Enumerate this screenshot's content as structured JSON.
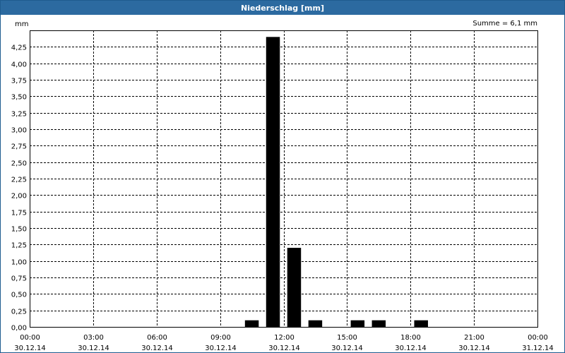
{
  "window": {
    "title": "Niederschlag [mm]"
  },
  "chart_data": {
    "type": "bar",
    "title": "Niederschlag [mm]",
    "ylabel": "mm",
    "annotation": "Summe = 6,1 mm",
    "ylim": [
      0,
      4.5
    ],
    "yticks": [
      "0,00",
      "0,25",
      "0,50",
      "0,75",
      "1,00",
      "1,25",
      "1,50",
      "1,75",
      "2,00",
      "2,25",
      "2,50",
      "2,75",
      "3,00",
      "3,25",
      "3,50",
      "3,75",
      "4,00",
      "4,25"
    ],
    "xlim_hours": [
      0,
      24
    ],
    "xticks": [
      {
        "time": "00:00",
        "date": "30.12.14"
      },
      {
        "time": "03:00",
        "date": "30.12.14"
      },
      {
        "time": "06:00",
        "date": "30.12.14"
      },
      {
        "time": "09:00",
        "date": "30.12.14"
      },
      {
        "time": "12:00",
        "date": "30.12.14"
      },
      {
        "time": "15:00",
        "date": "30.12.14"
      },
      {
        "time": "18:00",
        "date": "30.12.14"
      },
      {
        "time": "21:00",
        "date": "30.12.14"
      },
      {
        "time": "00:00",
        "date": "31.12.14"
      }
    ],
    "bars": [
      {
        "x": "10:30",
        "value": 0.1
      },
      {
        "x": "11:30",
        "value": 4.4
      },
      {
        "x": "12:30",
        "value": 1.2
      },
      {
        "x": "13:30",
        "value": 0.1
      },
      {
        "x": "15:30",
        "value": 0.1
      },
      {
        "x": "16:30",
        "value": 0.1
      },
      {
        "x": "18:30",
        "value": 0.1
      }
    ],
    "grid": true,
    "colors": {
      "bar": "#000000",
      "titlebar": "#2c6aa0"
    }
  }
}
